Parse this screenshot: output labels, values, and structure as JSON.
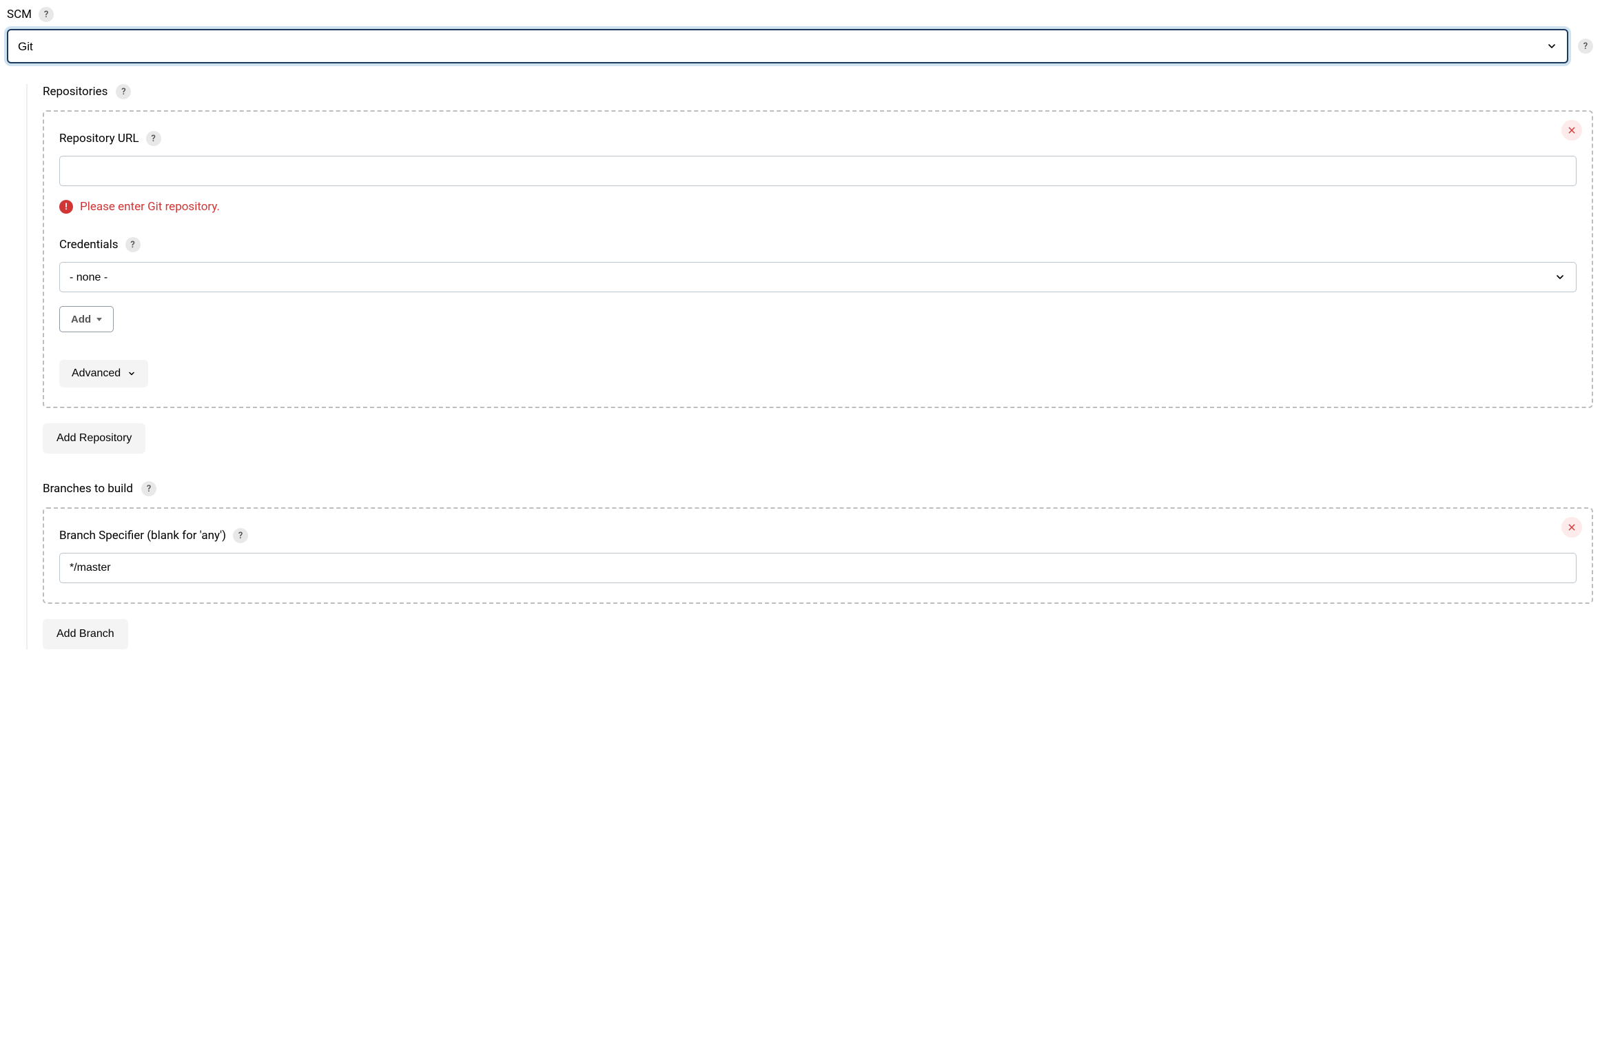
{
  "scm": {
    "label": "SCM",
    "selected": "Git"
  },
  "repositories": {
    "label": "Repositories",
    "repo_url_label": "Repository URL",
    "repo_url_value": "",
    "error_message": "Please enter Git repository.",
    "credentials_label": "Credentials",
    "credentials_selected": "- none -",
    "add_button_label": "Add",
    "advanced_button_label": "Advanced",
    "add_repository_label": "Add Repository"
  },
  "branches": {
    "label": "Branches to build",
    "specifier_label": "Branch Specifier (blank for 'any')",
    "specifier_value": "*/master",
    "add_branch_label": "Add Branch"
  }
}
